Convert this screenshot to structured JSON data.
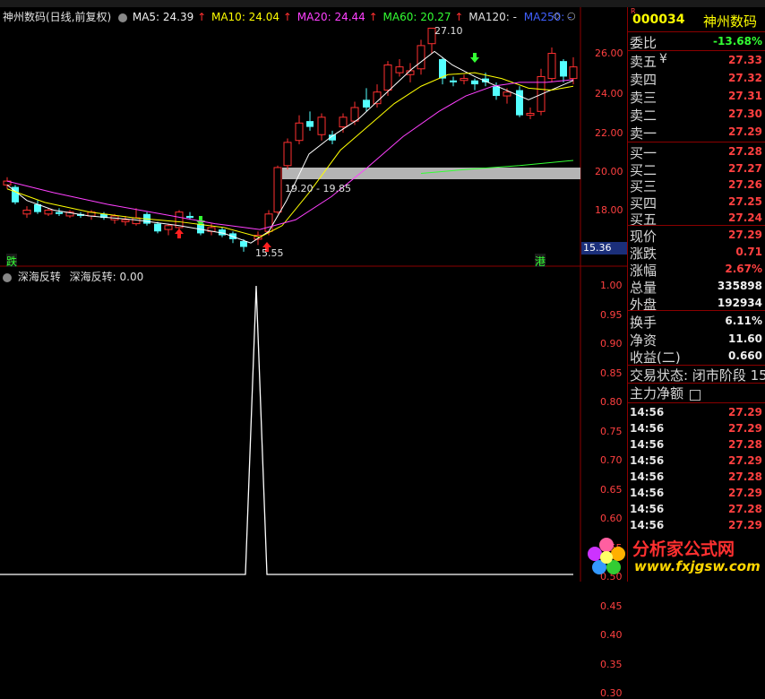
{
  "header": {
    "stock": "神州数码(日线,前复权)",
    "ma5": "MA5: 24.39",
    "ma10": "MA10: 24.04",
    "ma20": "MA20: 24.44",
    "ma60": "MA60: 20.27",
    "ma120": "MA120: -",
    "ma250": "MA250: -"
  },
  "main_chart": {
    "y_labels": [
      "26.00",
      "24.00",
      "22.00",
      "20.00",
      "18.00"
    ],
    "current_price_label": "15.36",
    "high_label": "27.10",
    "low_label": "15.55",
    "gap_label": "19.20 - 19.85",
    "left_tag": "跌",
    "right_tag": "港"
  },
  "sub_chart": {
    "title": "深海反转",
    "value_label": "深海反转: 0.00",
    "y_labels": [
      "1.00",
      "0.95",
      "0.90",
      "0.85",
      "0.80",
      "0.75",
      "0.70",
      "0.65",
      "0.60",
      "0.55",
      "0.50",
      "0.45",
      "0.40",
      "0.35",
      "0.30"
    ]
  },
  "quote": {
    "r_mark": "R",
    "code": "000034",
    "name": "神州数码",
    "wei_bi": {
      "label": "委比",
      "value": "-13.68%"
    },
    "asks": [
      {
        "label": "卖五",
        "sym": "¥",
        "price": "27.33"
      },
      {
        "label": "卖四",
        "sym": "",
        "price": "27.32"
      },
      {
        "label": "卖三",
        "sym": "",
        "price": "27.31"
      },
      {
        "label": "卖二",
        "sym": "",
        "price": "27.30"
      },
      {
        "label": "卖一",
        "sym": "",
        "price": "27.29"
      }
    ],
    "bids": [
      {
        "label": "买一",
        "price": "27.28"
      },
      {
        "label": "买二",
        "price": "27.27"
      },
      {
        "label": "买三",
        "price": "27.26"
      },
      {
        "label": "买四",
        "price": "27.25"
      },
      {
        "label": "买五",
        "price": "27.24"
      }
    ],
    "stats": [
      {
        "label": "现价",
        "value": "27.29",
        "color": "red"
      },
      {
        "label": "涨跌",
        "value": "0.71",
        "color": "red"
      },
      {
        "label": "涨幅",
        "value": "2.67%",
        "color": "red"
      },
      {
        "label": "总量",
        "value": "335898",
        "color": "white"
      },
      {
        "label": "外盘",
        "value": "192934",
        "color": "white"
      }
    ],
    "stats2": [
      {
        "label": "换手",
        "value": "6.11%",
        "color": "white"
      },
      {
        "label": "净资",
        "value": "11.60",
        "color": "white"
      },
      {
        "label": "收益(二)",
        "value": "0.660",
        "color": "white"
      }
    ],
    "status": "交易状态: 闭市阶段 15",
    "main_force": "主力净额",
    "ticks": [
      {
        "time": "14:56",
        "price": "27.29"
      },
      {
        "time": "14:56",
        "price": "27.29"
      },
      {
        "time": "14:56",
        "price": "27.28"
      },
      {
        "time": "14:56",
        "price": "27.29"
      },
      {
        "time": "14:56",
        "price": "27.28"
      },
      {
        "time": "14:56",
        "price": "27.29"
      },
      {
        "time": "14:56",
        "price": "27.28"
      },
      {
        "time": "14:56",
        "price": "27.29"
      }
    ]
  },
  "watermark": {
    "title": "分析家公式网",
    "url": "www.fxjgsw.com"
  },
  "colors": {
    "up": "#ff3030",
    "down": "#54ffff",
    "ma5": "#ffffff",
    "ma10": "#ffff00",
    "ma20": "#ff40ff",
    "ma60": "#33ff33",
    "grid": "#8b0000"
  }
}
